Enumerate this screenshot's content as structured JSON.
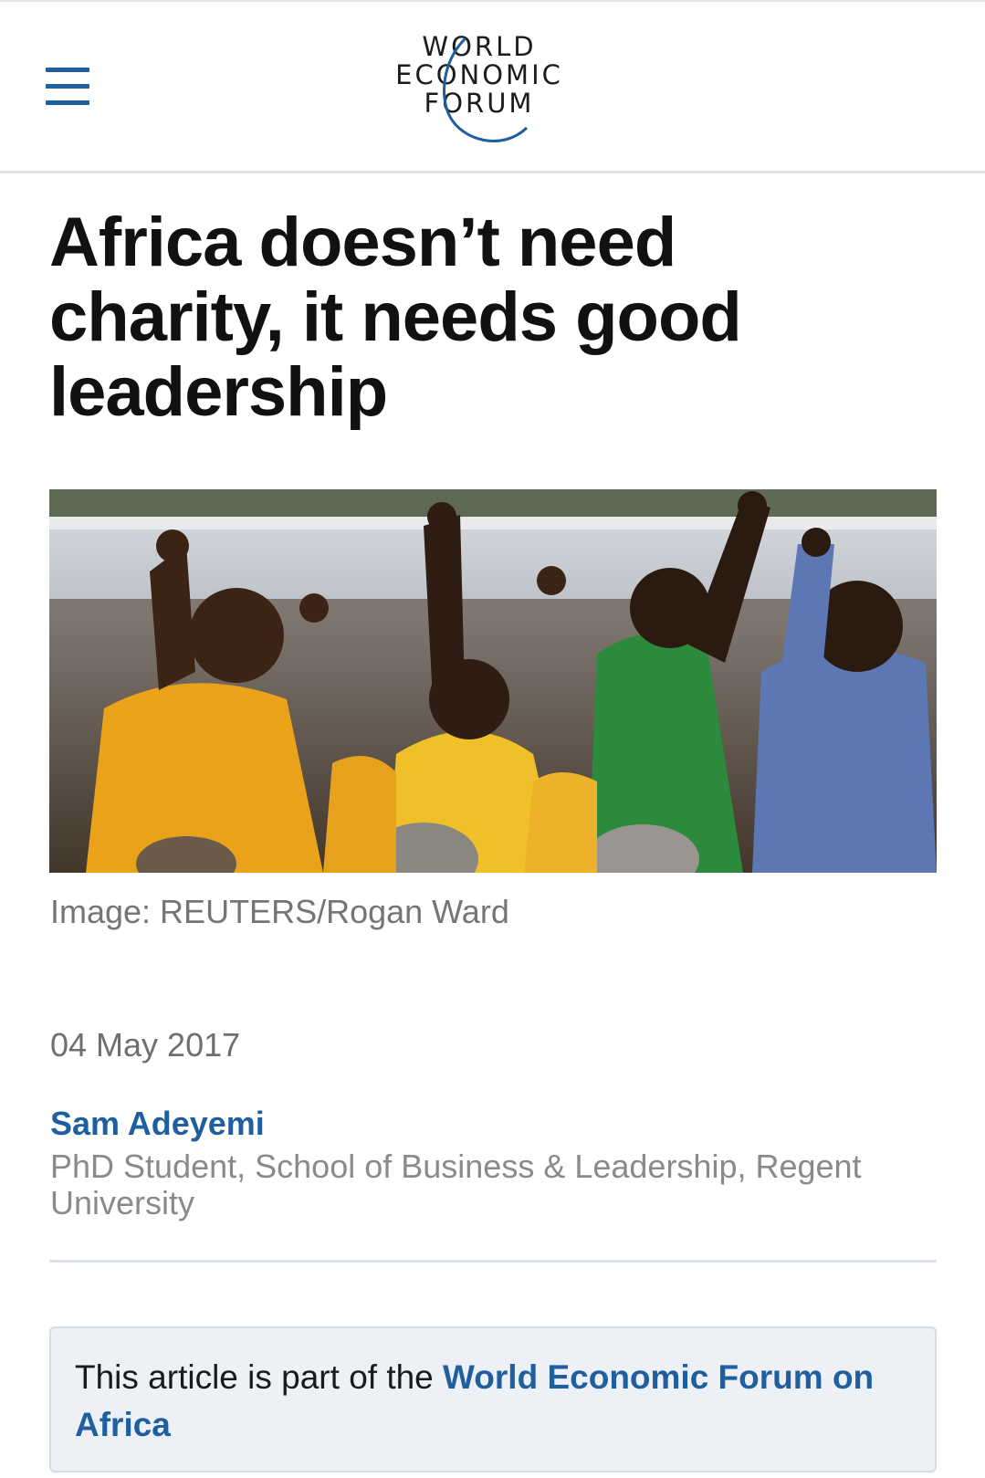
{
  "header": {
    "menu_icon": "hamburger-menu-icon",
    "logo": {
      "line1": "WORLD",
      "line2": "ECONOMIC",
      "line3": "FORUM",
      "color": "#1f5f9f"
    }
  },
  "article": {
    "headline": "Africa doesn’t need charity, it needs good leadership",
    "image_caption": "Image: REUTERS/Rogan Ward",
    "date": "04 May 2017",
    "author": {
      "name": "Sam Adeyemi",
      "title": "PhD Student, School of Business & Leadership, Regent University"
    },
    "notice": {
      "prefix": "This article is part of the ",
      "link_text": "World Economic Forum on Africa"
    }
  },
  "colors": {
    "brand_blue": "#1f5f9f",
    "headline": "#111111",
    "meta_gray": "#757575",
    "notice_bg": "#edf0f4"
  }
}
